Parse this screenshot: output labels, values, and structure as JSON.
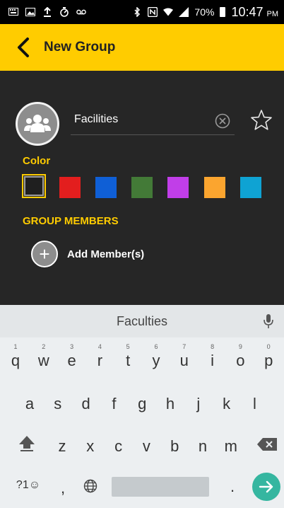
{
  "status_bar": {
    "battery": "70%",
    "time": "10:47",
    "ampm": "PM",
    "icons": [
      "keyboard-icon",
      "image-icon",
      "upload-icon",
      "timer-icon",
      "voicemail-icon",
      "bluetooth-icon",
      "nfc-icon",
      "wifi-icon",
      "signal-icon",
      "battery-icon"
    ]
  },
  "header": {
    "title": "New Group",
    "accent": "#ffcc00"
  },
  "group": {
    "name_value": "Facilities",
    "color_label": "Color",
    "members_label": "GROUP MEMBERS",
    "add_member_label": "Add Member(s)",
    "swatches": [
      "#1f1f1f",
      "#e31e1e",
      "#0f5fd6",
      "#437a37",
      "#c13ee8",
      "#fba52f",
      "#0fa3d3"
    ]
  },
  "keyboard": {
    "suggestion": "Faculties",
    "row1": [
      "q",
      "w",
      "e",
      "r",
      "t",
      "y",
      "u",
      "i",
      "o",
      "p"
    ],
    "row1_hints": [
      "1",
      "2",
      "3",
      "4",
      "5",
      "6",
      "7",
      "8",
      "9",
      "0"
    ],
    "row2": [
      "a",
      "s",
      "d",
      "f",
      "g",
      "h",
      "j",
      "k",
      "l"
    ],
    "row3": [
      "z",
      "x",
      "c",
      "v",
      "b",
      "n",
      "m"
    ],
    "symbols_key": "?1☺",
    "comma_key": ",",
    "period_key": "."
  }
}
